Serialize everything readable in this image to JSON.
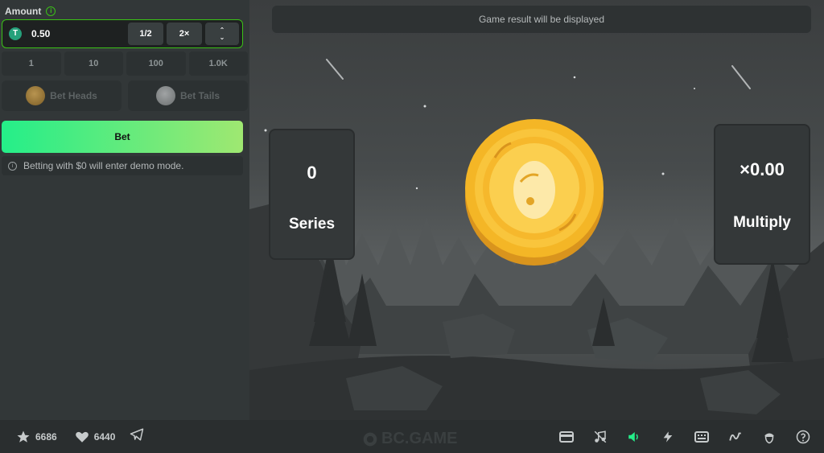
{
  "bet_panel": {
    "amount_label": "Amount",
    "amount_value": "0.50",
    "currency_glyph": "T",
    "half_label": "1/2",
    "double_label": "2×",
    "arrow_up": "⌃",
    "arrow_down": "⌄",
    "quick_amounts": [
      "1",
      "10",
      "100",
      "1.0K"
    ],
    "bet_heads_label": "Bet Heads",
    "bet_tails_label": "Bet Tails",
    "bet_button_label": "Bet",
    "demo_note": "Betting with $0 will enter demo mode."
  },
  "game": {
    "result_text": "Game result will be displayed",
    "series_value": "0",
    "series_label": "Series",
    "multiply_value": "×0.00",
    "multiply_label": "Multiply"
  },
  "footer": {
    "favorites_count": "6686",
    "likes_count": "6440",
    "brand": "BC.GAME",
    "icons": [
      "star-icon",
      "heart-icon",
      "telegram-icon",
      "card-icon",
      "music-icon",
      "sound-icon",
      "lightning-icon",
      "keyboard-icon",
      "chart-icon",
      "acorn-icon",
      "help-icon"
    ]
  },
  "colors": {
    "accent": "#3bc117",
    "bet_gradient_start": "#24ee89",
    "bet_gradient_end": "#9fe871",
    "coin_gold": "#f6c02f",
    "usdt_green": "#26a17b"
  }
}
